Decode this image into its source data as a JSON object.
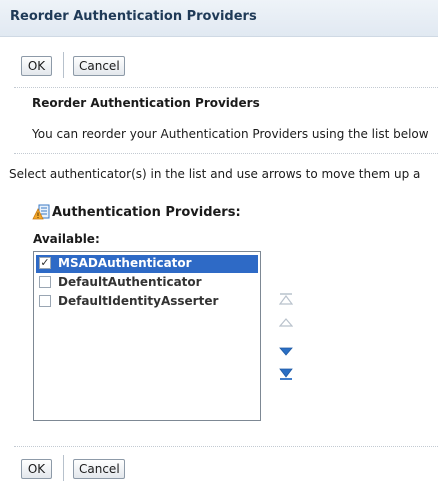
{
  "header": {
    "title": "Reorder Authentication Providers"
  },
  "top_buttons": {
    "ok": "OK",
    "cancel": "Cancel"
  },
  "section": {
    "title": "Reorder Authentication Providers",
    "description": "You can reorder your Authentication Providers using the list below",
    "instruction": "Select authenticator(s) in the list and use arrows to move them up a"
  },
  "providers": {
    "title": "Authentication Providers:",
    "available_label": "Available:",
    "items": [
      {
        "label": "MSADAuthenticator",
        "checked": true,
        "selected": true
      },
      {
        "label": "DefaultAuthenticator",
        "checked": false,
        "selected": false
      },
      {
        "label": "DefaultIdentityAsserter",
        "checked": false,
        "selected": false
      }
    ]
  },
  "arrows": [
    "move-top-icon",
    "move-up-icon",
    "move-down-icon",
    "move-bottom-icon"
  ],
  "colors": {
    "selection": "#2e6ac6",
    "header": "#e6edf4",
    "arrow_active": "#2b6fc4",
    "arrow_inactive": "#b9c2cc"
  },
  "bottom_buttons": {
    "ok": "OK",
    "cancel": "Cancel"
  }
}
